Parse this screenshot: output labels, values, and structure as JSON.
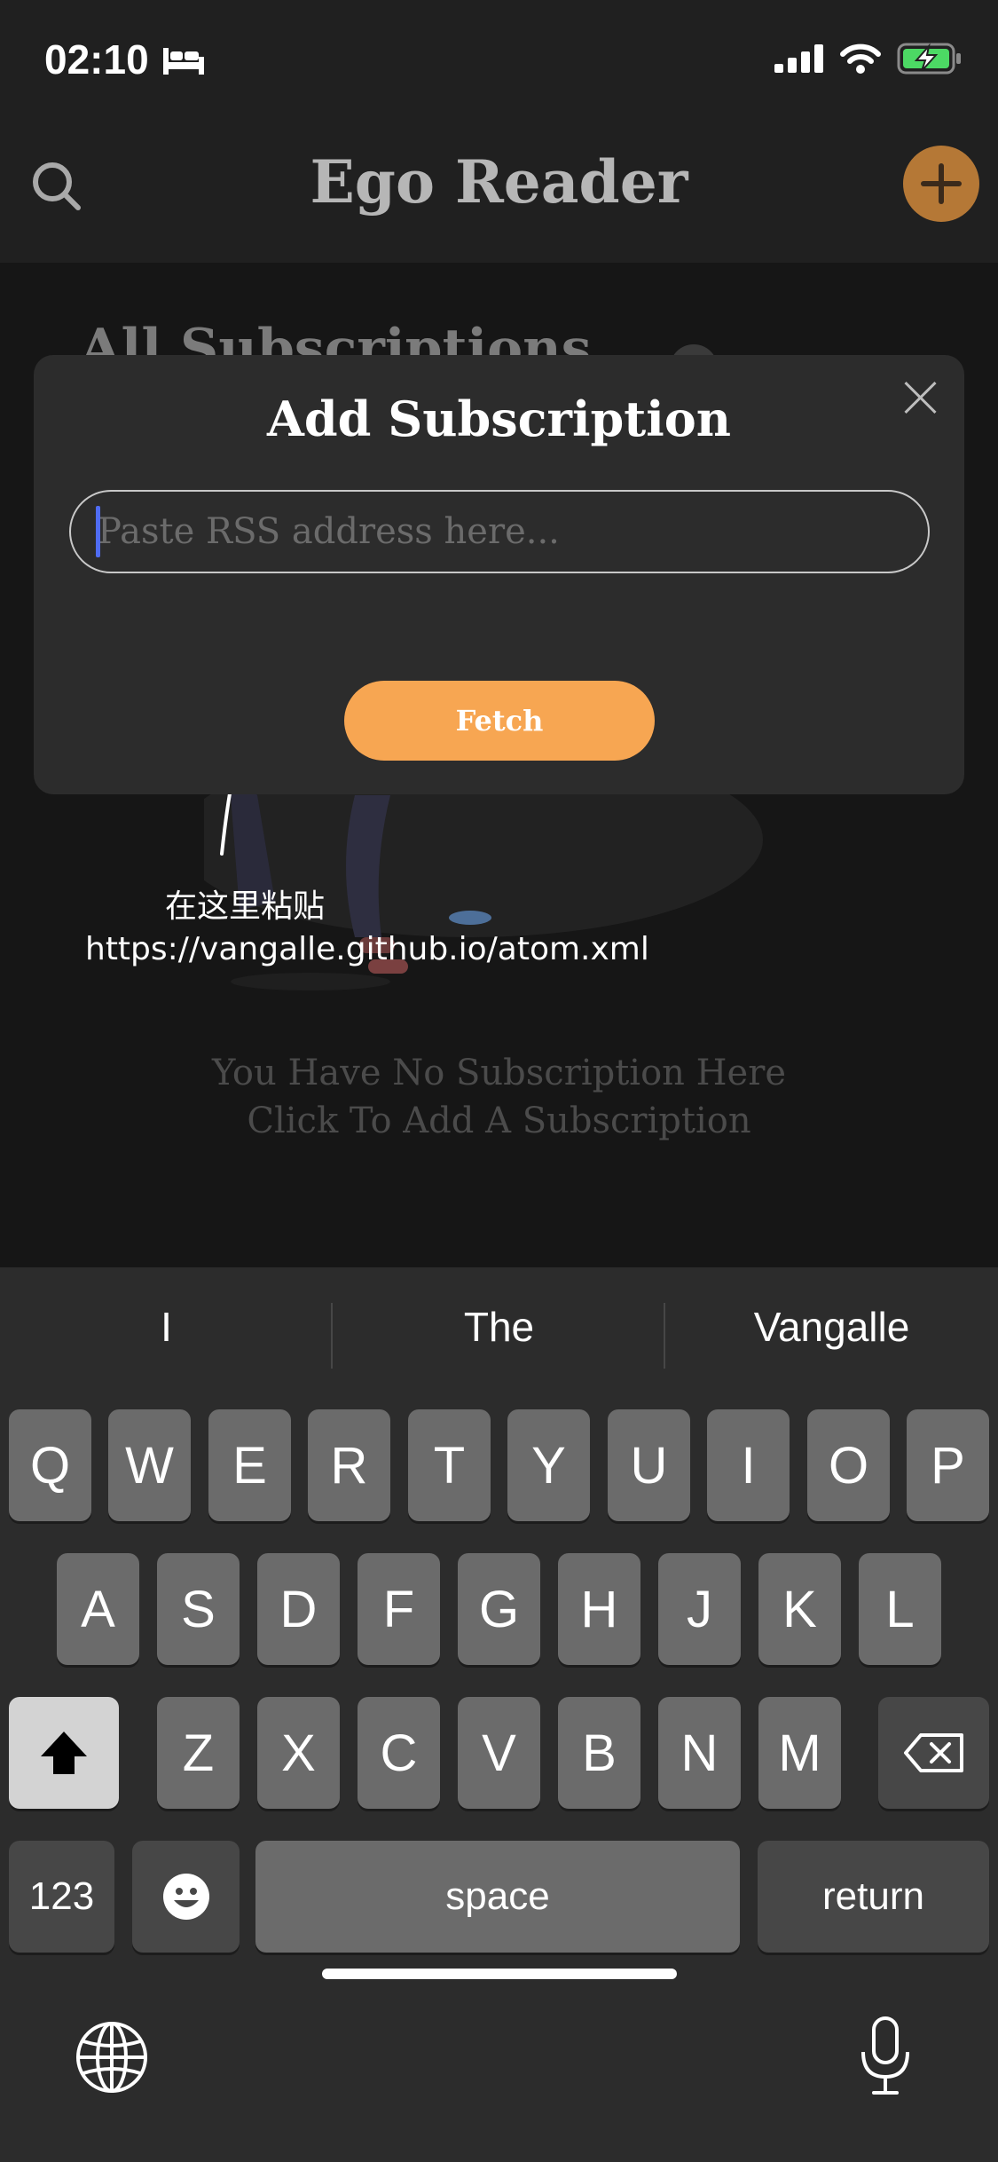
{
  "status_bar": {
    "time": "02:10"
  },
  "header": {
    "title": "Ego Reader"
  },
  "background": {
    "section_heading": "All Subscriptions",
    "empty_line_1": "You Have No Subscription Here",
    "empty_line_2": "Click To Add A Subscription"
  },
  "annotation": {
    "text": "在这里粘贴https://vangalle.github.io/atom.xml"
  },
  "modal": {
    "title": "Add Subscription",
    "input_placeholder": "Paste RSS address here...",
    "input_value": "",
    "fetch_label": "Fetch"
  },
  "keyboard": {
    "suggestions": [
      "I",
      "The",
      "Vangalle"
    ],
    "row1": [
      "Q",
      "W",
      "E",
      "R",
      "T",
      "Y",
      "U",
      "I",
      "O",
      "P"
    ],
    "row2": [
      "A",
      "S",
      "D",
      "F",
      "G",
      "H",
      "J",
      "K",
      "L"
    ],
    "row3": [
      "Z",
      "X",
      "C",
      "V",
      "B",
      "N",
      "M"
    ],
    "numbers_label": "123",
    "space_label": "space",
    "return_label": "return"
  },
  "colors": {
    "accent": "#f7a652",
    "add_button": "#b57836",
    "caret": "#4f6cf3",
    "battery": "#4cd964"
  },
  "icons": {
    "search": "search-icon",
    "add": "plus-icon",
    "close": "close-icon",
    "shift": "shift-icon",
    "delete": "backspace-icon",
    "emoji": "emoji-icon",
    "globe": "globe-icon",
    "mic": "microphone-icon"
  }
}
